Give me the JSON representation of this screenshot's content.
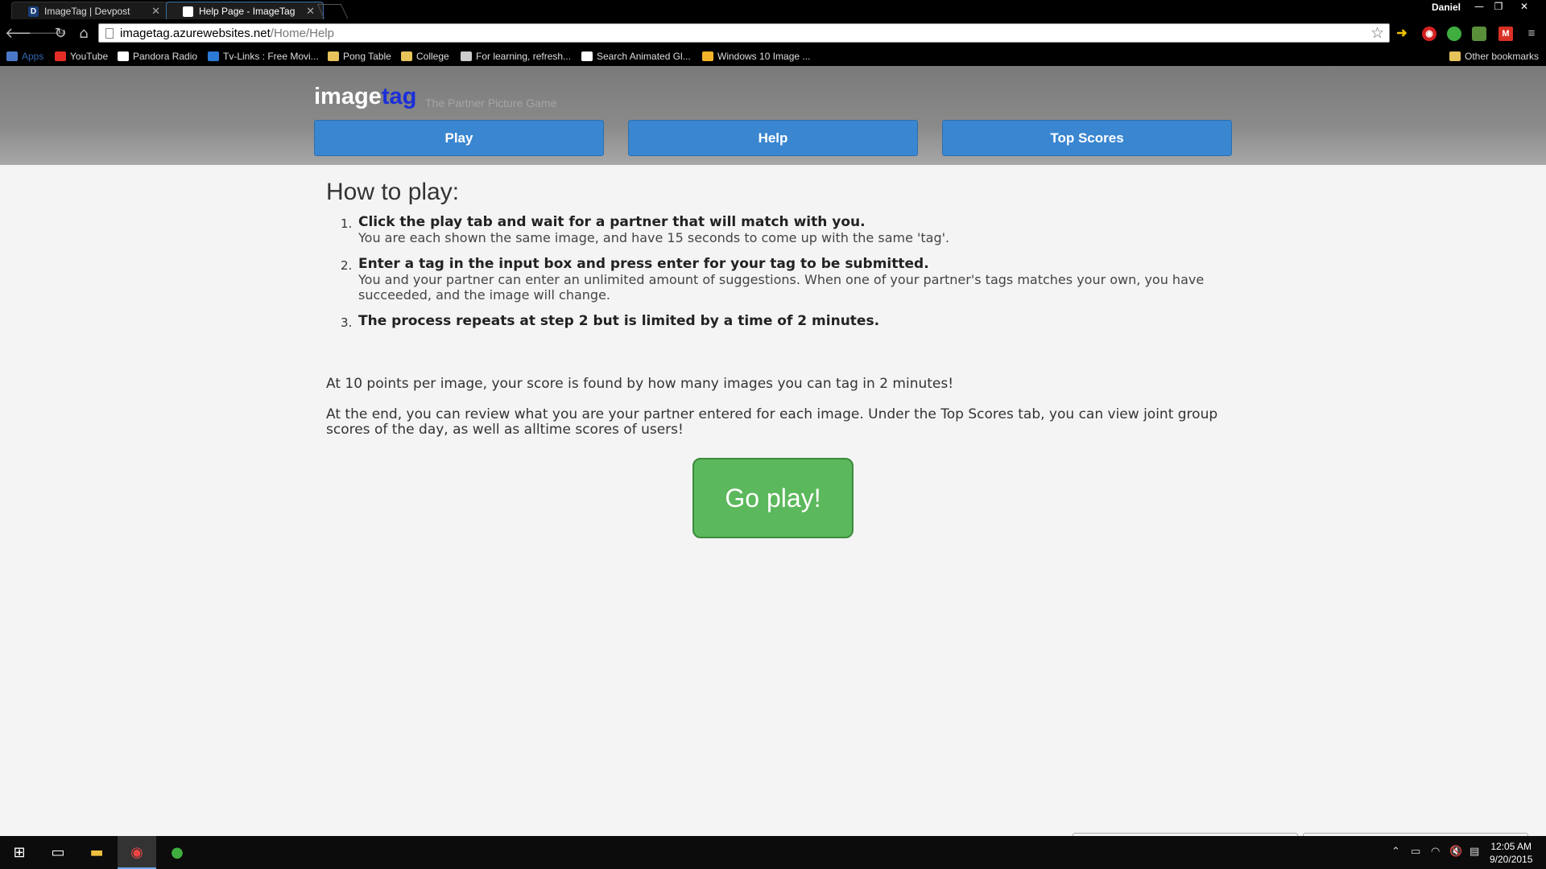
{
  "browser": {
    "tabs": [
      {
        "label": "ImageTag | Devpost",
        "favicon": "D"
      },
      {
        "label": "Help Page - ImageTag"
      }
    ],
    "user": "Daniel",
    "url_host": "imagetag.azurewebsites.net",
    "url_path": "/Home/Help",
    "bookmarks": [
      "Apps",
      "YouTube",
      "Pandora Radio",
      "Tv-Links : Free Movi...",
      "Pong Table",
      "College",
      "For learning, refresh...",
      "Search Animated Gl...",
      "Windows 10 Image ..."
    ],
    "other_bookmarks": "Other bookmarks"
  },
  "site": {
    "logo_image": "image",
    "logo_tag": "tag",
    "tagline": "The Partner Picture Game",
    "nav": [
      "Play",
      "Help",
      "Top Scores"
    ]
  },
  "help": {
    "title": "How to play:",
    "steps": [
      {
        "num": "1.",
        "lead": "Click the play tab and wait for a partner that will match with you.",
        "detail": "You are each shown the same image, and have 15 seconds to come up with the same 'tag'."
      },
      {
        "num": "2.",
        "lead": "Enter a tag in the input box and press enter for your tag to be submitted.",
        "detail": "You and your partner can enter an unlimited amount of suggestions. When one of your partner's tags matches your own, you have succeeded, and the image will change."
      },
      {
        "num": "3.",
        "lead": "The process repeats at step 2 but is limited by a time of 2 minutes.",
        "detail": ""
      }
    ],
    "para1": "At 10 points per image, your score is found by how many images you can tag in 2 minutes!",
    "para2": "At the end, you can review what you are your partner entered for each image. Under the Top Scores tab, you can view joint group scores of the day, as well as alltime scores of users!",
    "cta": "Go play!"
  },
  "taskbar": {
    "time": "12:05 AM",
    "date": "9/20/2015"
  },
  "colors": {
    "nav_button": "#3a86d0",
    "cta_button": "#5cb85c",
    "logo_tag": "#1b2fd9"
  }
}
